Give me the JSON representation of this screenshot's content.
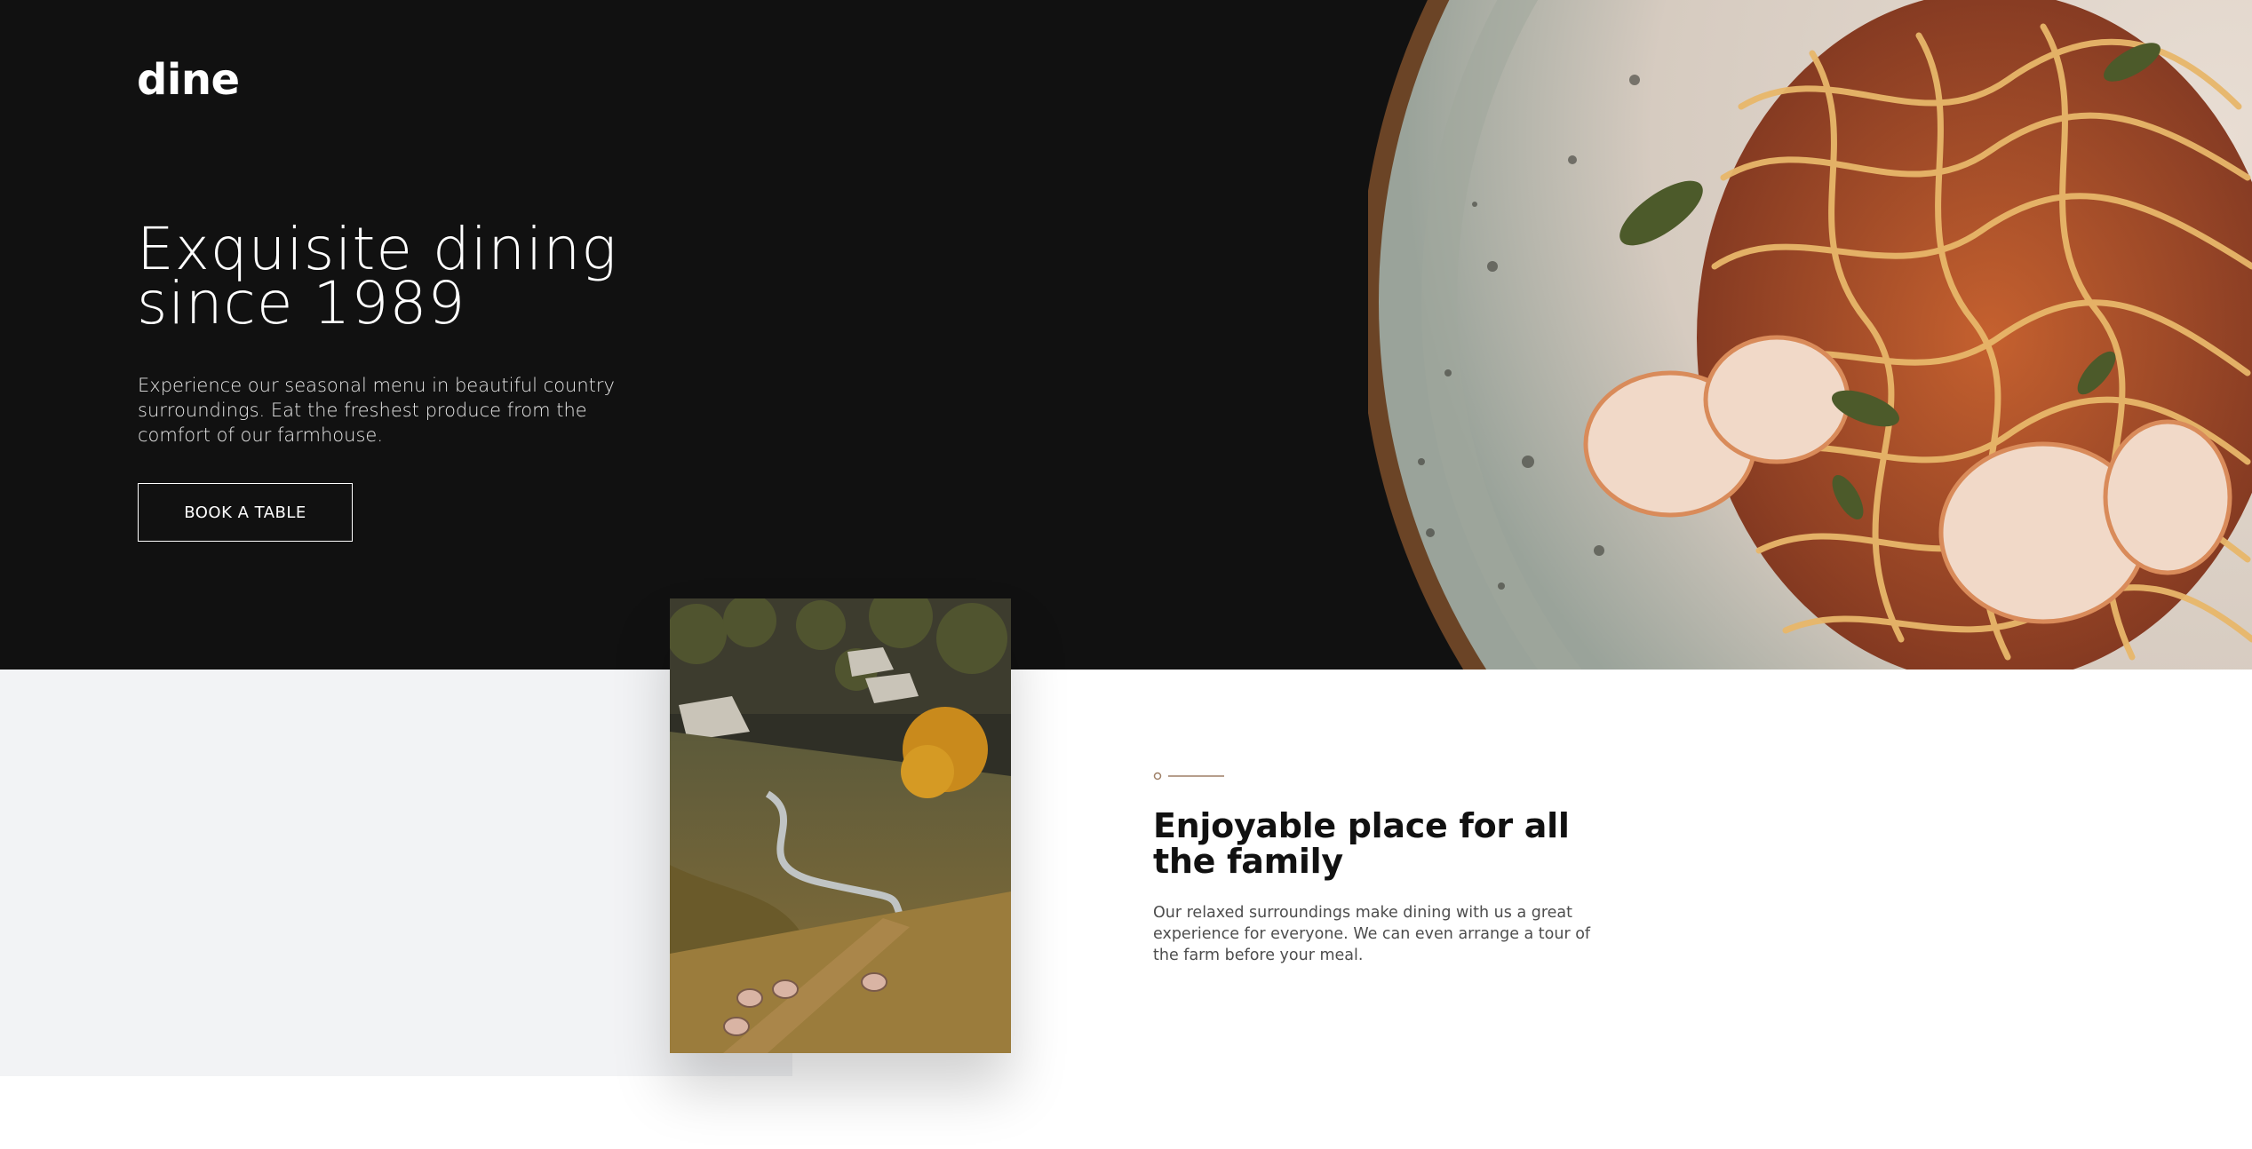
{
  "header": {
    "logo": "dine"
  },
  "hero": {
    "title": "Exquisite dining since 1989",
    "description": "Experience our seasonal menu in beautiful country surroundings. Eat the freshest produce from the comfort of our farmhouse.",
    "button_label": "BOOK A TABLE"
  },
  "features": {
    "title": "Enjoyable place for all the family",
    "description": "Our relaxed surroundings make dining with us a great experience for everyone. We can even arrange a tour of the farm before your meal."
  },
  "colors": {
    "hero_background": "#111111",
    "accent": "#9e7f66",
    "section_band": "#f2f3f5"
  }
}
